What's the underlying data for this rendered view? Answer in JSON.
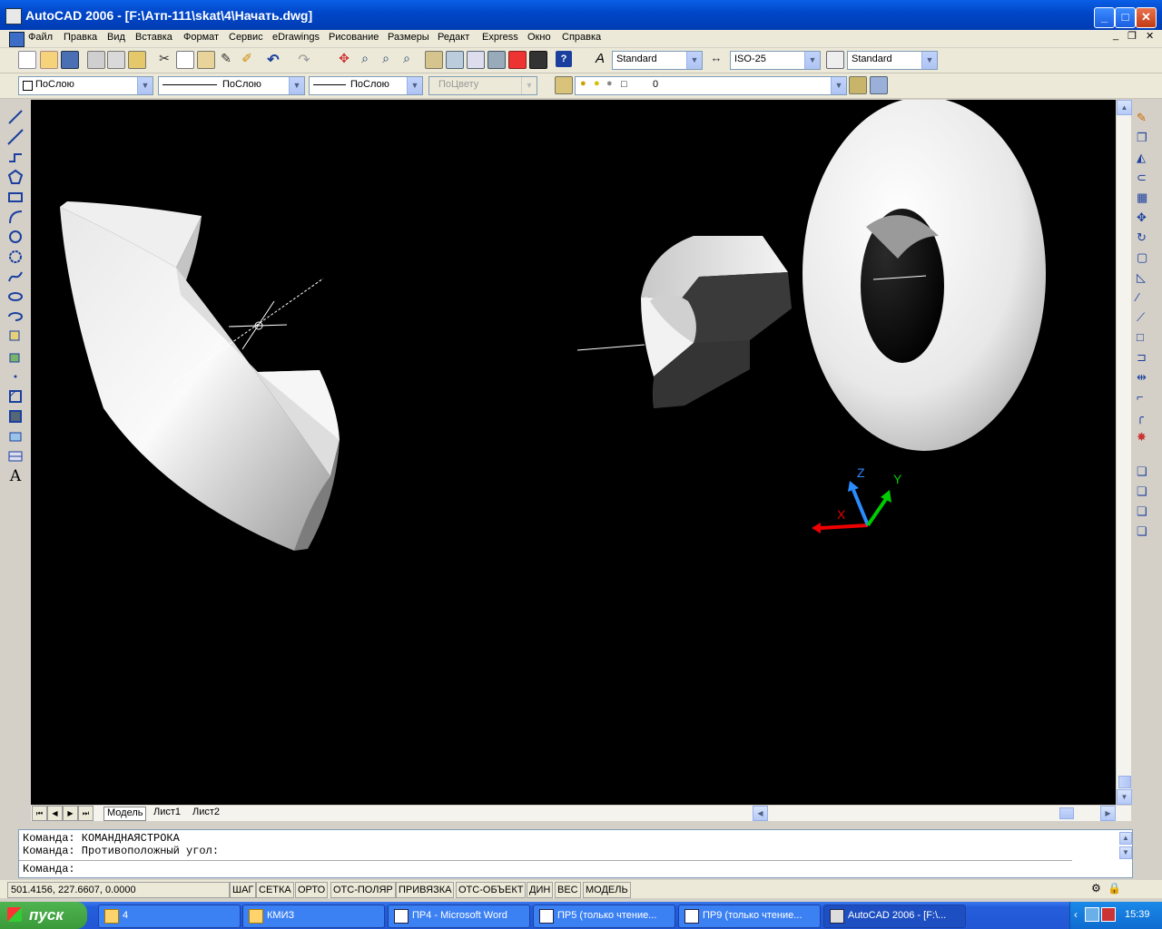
{
  "window": {
    "title": "AutoCAD 2006 - [F:\\Атп-111\\skat\\4\\Начать.dwg]",
    "min": "_",
    "max": "□",
    "close": "✕"
  },
  "menu": [
    "Файл",
    "Правка",
    "Вид",
    "Вставка",
    "Формат",
    "Сервис",
    "eDrawings",
    "Рисование",
    "Размеры",
    "Редакт",
    "Express",
    "Окно",
    "Справка"
  ],
  "toolbar1": {
    "text_style": "Standard",
    "dim_style": "ISO-25",
    "table_style": "Standard"
  },
  "toolbar2": {
    "color": "ПоСлою",
    "linetype": "ПоСлою",
    "lineweight": "ПоСлою",
    "plotstyle": "ПоЦвету",
    "layer": "0"
  },
  "ucs": {
    "x": "X",
    "y": "Y",
    "z": "Z"
  },
  "tabs": [
    "Модель",
    "Лист1",
    "Лист2"
  ],
  "command": {
    "line1": "Команда: КОМАНДНАЯСТРОКА",
    "line2": "Команда: Противоположный угол:",
    "prompt": "Команда:"
  },
  "status": {
    "coords": "501.4156, 227.6607, 0.0000",
    "toggles": [
      "ШАГ",
      "СЕТКА",
      "ОРТО",
      "ОТС-ПОЛЯР",
      "ПРИВЯЗКА",
      "ОТС-ОБЪЕКТ",
      "ДИН",
      "ВЕС",
      "МОДЕЛЬ"
    ]
  },
  "taskbar": {
    "start": "пуск",
    "tasks": [
      "4",
      "КМИЗ",
      "ПР4 - Microsoft Word",
      "ПР5 (только чтение...",
      "ПР9 (только чтение...",
      "AutoCAD 2006 - [F:\\..."
    ],
    "clock": "15:39"
  }
}
